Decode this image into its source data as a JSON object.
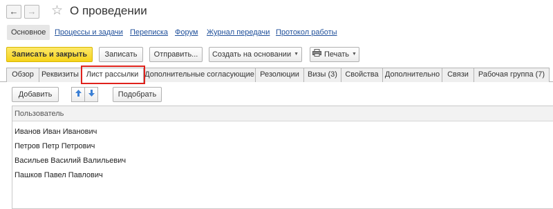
{
  "window": {
    "back_glyph": "←",
    "forward_glyph": "→",
    "star_glyph": "☆",
    "title": "О проведении"
  },
  "sections": {
    "active": "Основное",
    "links": [
      "Процессы и задачи",
      "Переписка",
      "Форум",
      "Журнал передачи",
      "Протокол работы"
    ]
  },
  "commands": {
    "save_close": "Записать и закрыть",
    "save": "Записать",
    "send": "Отправить...",
    "create_based": "Создать на основании",
    "print": "Печать",
    "dropdown_glyph": "▼"
  },
  "tabs": [
    "Обзор",
    "Реквизиты",
    "Лист рассылки",
    "Дополнительные согласующие",
    "Резолюции",
    "Визы (3)",
    "Свойства",
    "Дополнительно",
    "Связи",
    "Рабочая группа (7)"
  ],
  "active_tab_index": 2,
  "list_toolbar": {
    "add": "Добавить",
    "up_glyph": "🡅",
    "down_glyph": "🡇",
    "pick": "Подобрать"
  },
  "table": {
    "column": "Пользователь",
    "rows": [
      "Иванов Иван Иванович",
      "Петров Петр Петрович",
      "Васильев Василий Валильевич",
      "Пашков Павел Павлович"
    ]
  },
  "colors": {
    "accent_yellow": "#f6d31a",
    "link_blue": "#1f4f9a",
    "highlight_red": "#e0211b",
    "arrow_blue": "#3a7fd5"
  }
}
